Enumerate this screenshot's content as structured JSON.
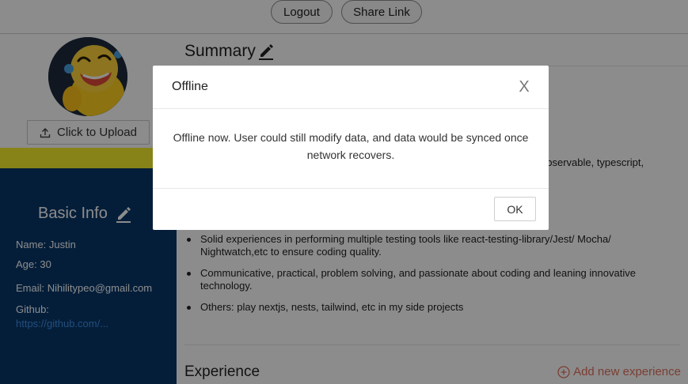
{
  "toolbar": {
    "logout_label": "Logout",
    "share_label": "Share Link"
  },
  "sidebar": {
    "upload_label": "Click to Upload",
    "basic_info": {
      "title": "Basic Info",
      "name": "Name: Justin",
      "age": "Age: 30",
      "email": "Email: Nihilitypeo@gmail.com",
      "github_label": "Github:",
      "github_link": "https://github.com/..."
    }
  },
  "main": {
    "summary_title": "Summary",
    "partial_text": "observable, typescript,",
    "bullets": [
      {
        "text": "Solid experiences in performing multiple testing tools like react-testing-library/Jest/ Mocha/ Nightwatch,etc to ensure coding quality."
      },
      {
        "text": "Communicative, practical, problem solving, and passionate about coding and leaning innovative technology."
      },
      {
        "text": "Others: play nextjs, nests, tailwind, etc in my side projects"
      }
    ],
    "experience_title": "Experience",
    "add_experience_label": "Add new experience"
  },
  "modal": {
    "title": "Offline",
    "body": "Offline now. User could still modify data, and data would be synced once network recovers.",
    "ok_label": "OK",
    "close_glyph": "X"
  },
  "colors": {
    "navy": "#08386b",
    "yellow": "#f8ef2e",
    "link": "#3f8ee4",
    "accent_add": "#e3705d"
  }
}
